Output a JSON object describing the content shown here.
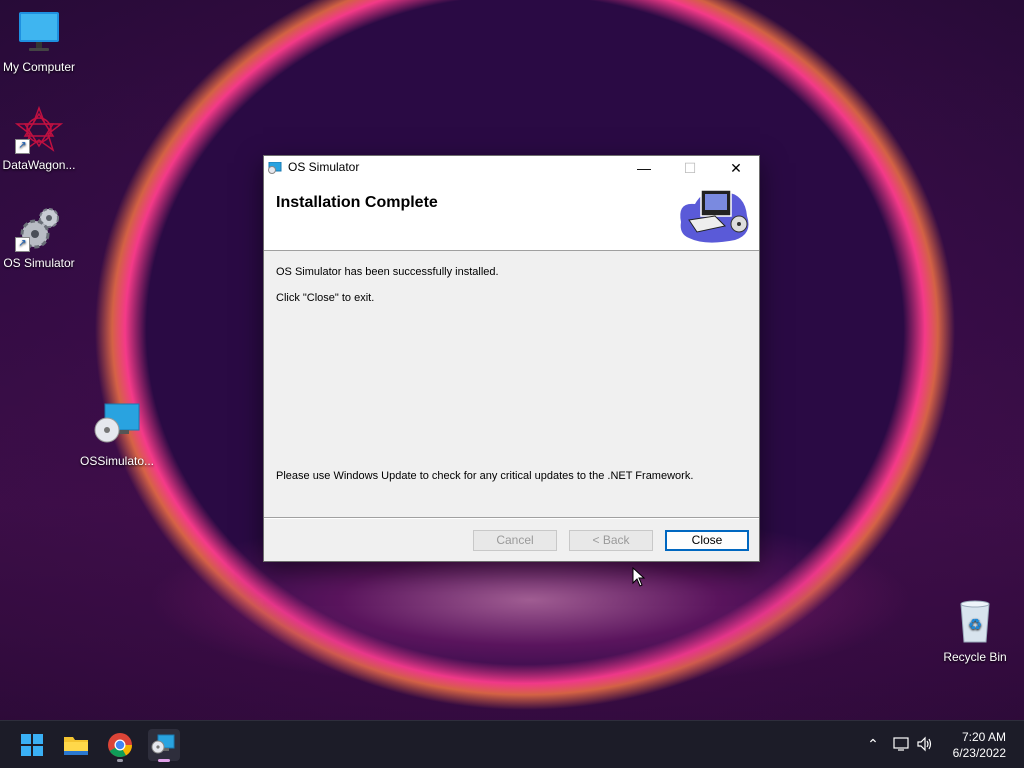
{
  "desktop": {
    "icons": [
      {
        "label": "My Computer"
      },
      {
        "label": "DataWagon..."
      },
      {
        "label": "OS Simulator"
      },
      {
        "label": "OSSimulato..."
      },
      {
        "label": "Recycle Bin"
      }
    ]
  },
  "dialog": {
    "title": "OS Simulator",
    "heading": "Installation Complete",
    "message_success": "OS Simulator has been successfully installed.",
    "message_exit": "Click \"Close\" to exit.",
    "message_update": "Please use Windows Update to check for any critical updates to the .NET Framework.",
    "buttons": {
      "cancel": "Cancel",
      "back": "< Back",
      "close": "Close"
    },
    "button_states": {
      "cancel": "disabled",
      "back": "disabled",
      "close": "default"
    }
  },
  "taskbar": {
    "clock": {
      "time": "7:20 AM",
      "date": "6/23/2022"
    },
    "apps": [
      "start-icon",
      "file-explorer-icon",
      "chrome-icon",
      "os-simulator-installer-icon"
    ]
  },
  "colors": {
    "accent": "#0067c0",
    "taskbar": "#1c1c28",
    "dialog_bg": "#f0f0f0"
  }
}
